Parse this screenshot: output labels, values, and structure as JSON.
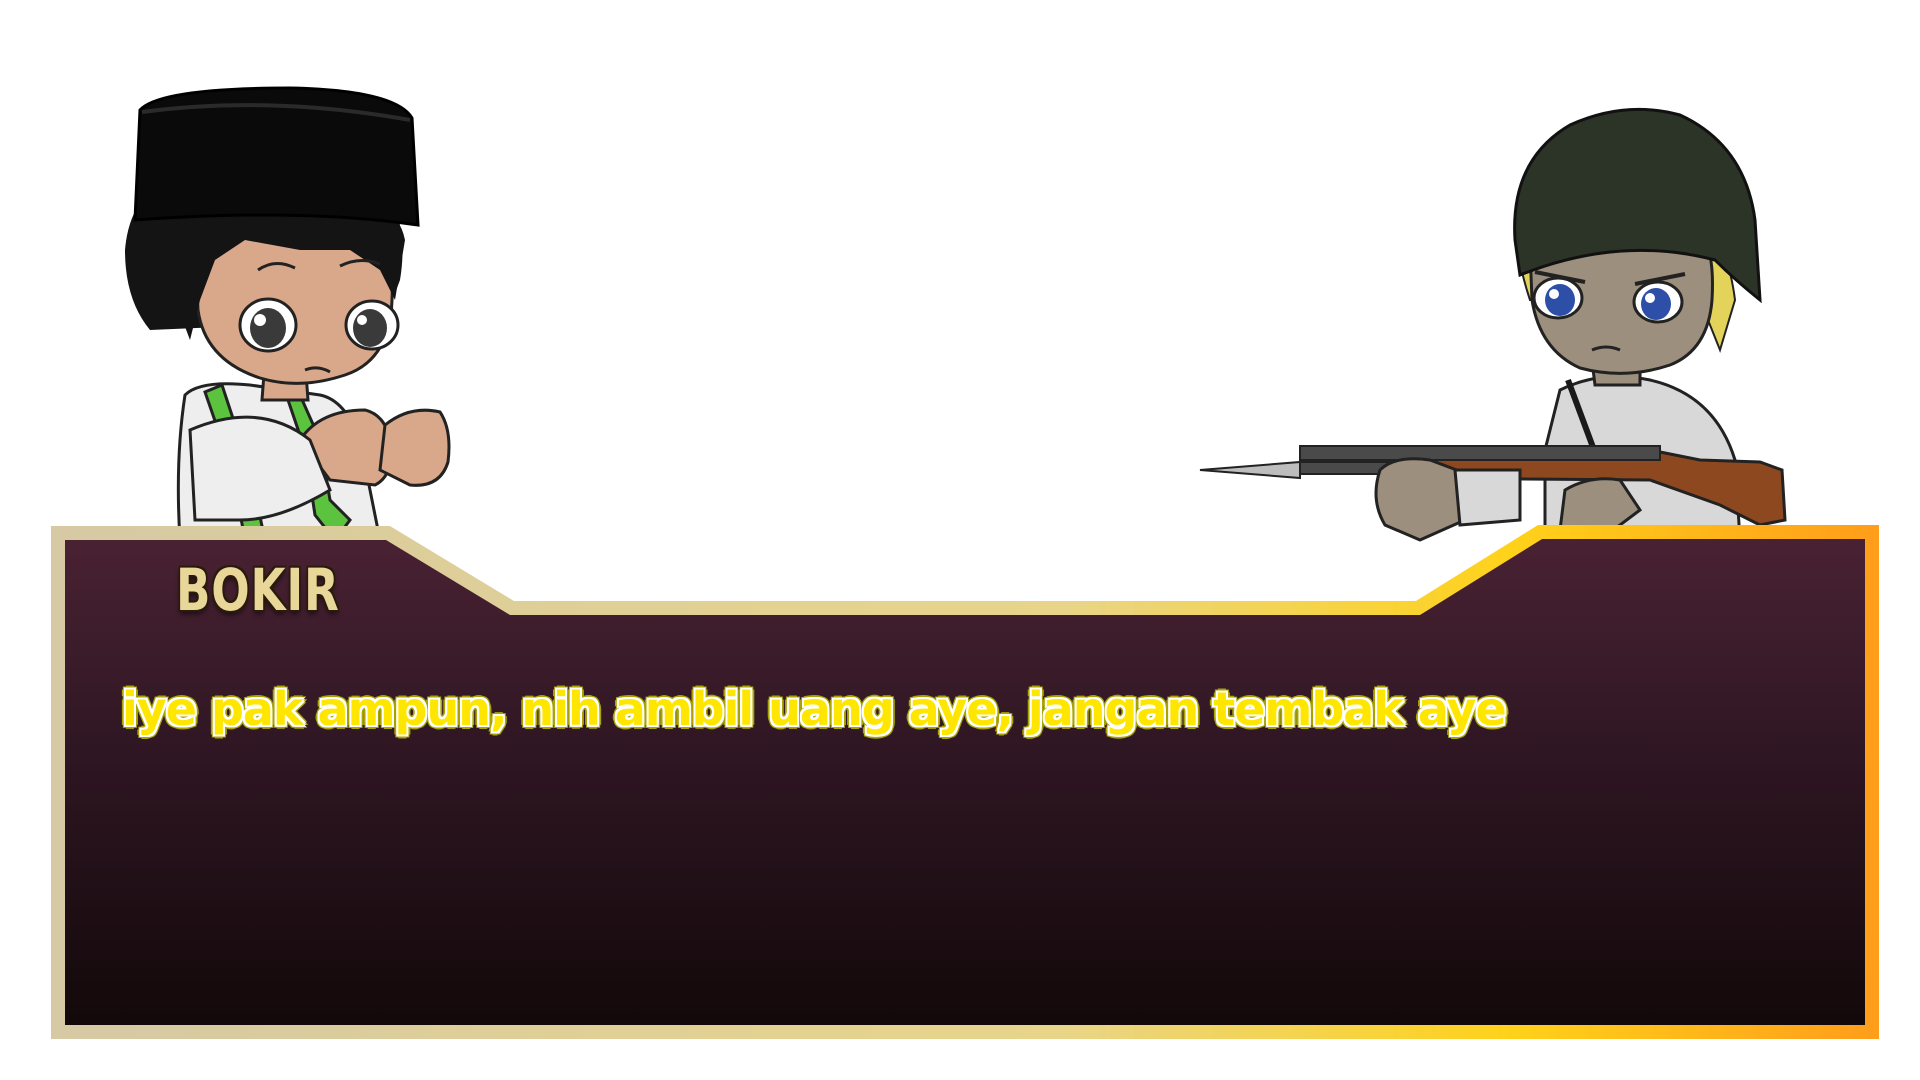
{
  "dialogue": {
    "speaker_name": "BOKIR",
    "text": "iye pak ampun, nih ambil uang aye, jangan tembak aye"
  },
  "characters": {
    "left": {
      "icon": "bokir-character-portrait"
    },
    "right": {
      "icon": "soldier-character-portrait"
    }
  },
  "colors": {
    "box_top": "#4a2233",
    "box_bottom": "#120809",
    "frame_left": "#d6c9a4",
    "frame_right": "#ffcc1a",
    "text_fill": "#ffe600",
    "name_fill": "#e9d79a"
  }
}
